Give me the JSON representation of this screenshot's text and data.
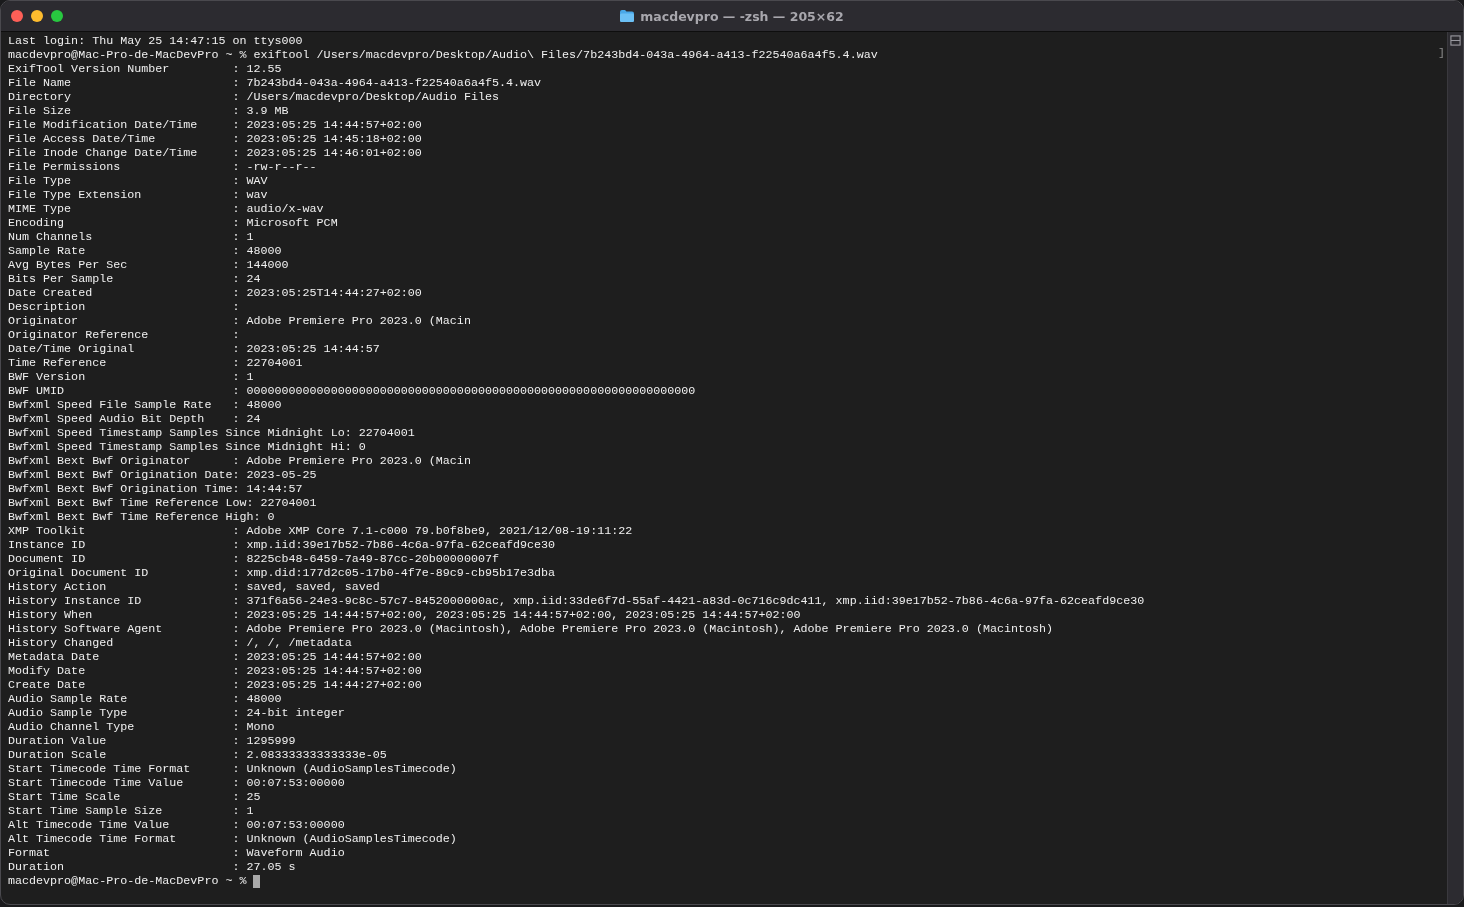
{
  "window": {
    "title": "macdevpro — -zsh — 205×62"
  },
  "terminal": {
    "lines": [
      "Last login: Thu May 25 14:47:15 on ttys000",
      "macdevpro@Mac-Pro-de-MacDevPro ~ % exiftool /Users/macdevpro/Desktop/Audio\\ Files/7b243bd4-043a-4964-a413-f22540a6a4f5.4.wav",
      "ExifTool Version Number         : 12.55",
      "File Name                       : 7b243bd4-043a-4964-a413-f22540a6a4f5.4.wav",
      "Directory                       : /Users/macdevpro/Desktop/Audio Files",
      "File Size                       : 3.9 MB",
      "File Modification Date/Time     : 2023:05:25 14:44:57+02:00",
      "File Access Date/Time           : 2023:05:25 14:45:18+02:00",
      "File Inode Change Date/Time     : 2023:05:25 14:46:01+02:00",
      "File Permissions                : -rw-r--r--",
      "File Type                       : WAV",
      "File Type Extension             : wav",
      "MIME Type                       : audio/x-wav",
      "Encoding                        : Microsoft PCM",
      "Num Channels                    : 1",
      "Sample Rate                     : 48000",
      "Avg Bytes Per Sec               : 144000",
      "Bits Per Sample                 : 24",
      "Date Created                    : 2023:05:25T14:44:27+02:00",
      "Description                     :",
      "Originator                      : Adobe Premiere Pro 2023.0 (Macin",
      "Originator Reference            :",
      "Date/Time Original              : 2023:05:25 14:44:57",
      "Time Reference                  : 22704001",
      "BWF Version                     : 1",
      "BWF UMID                        : 0000000000000000000000000000000000000000000000000000000000000000",
      "Bwfxml Speed File Sample Rate   : 48000",
      "Bwfxml Speed Audio Bit Depth    : 24",
      "Bwfxml Speed Timestamp Samples Since Midnight Lo: 22704001",
      "Bwfxml Speed Timestamp Samples Since Midnight Hi: 0",
      "Bwfxml Bext Bwf Originator      : Adobe Premiere Pro 2023.0 (Macin",
      "Bwfxml Bext Bwf Origination Date: 2023-05-25",
      "Bwfxml Bext Bwf Origination Time: 14:44:57",
      "Bwfxml Bext Bwf Time Reference Low: 22704001",
      "Bwfxml Bext Bwf Time Reference High: 0",
      "XMP Toolkit                     : Adobe XMP Core 7.1-c000 79.b0f8be9, 2021/12/08-19:11:22",
      "Instance ID                     : xmp.iid:39e17b52-7b86-4c6a-97fa-62ceafd9ce30",
      "Document ID                     : 8225cb48-6459-7a49-87cc-20b00000007f",
      "Original Document ID            : xmp.did:177d2c05-17b0-4f7e-89c9-cb95b17e3dba",
      "History Action                  : saved, saved, saved",
      "History Instance ID             : 371f6a56-24e3-9c8c-57c7-8452000000ac, xmp.iid:33de6f7d-55af-4421-a83d-0c716c9dc411, xmp.iid:39e17b52-7b86-4c6a-97fa-62ceafd9ce30",
      "History When                    : 2023:05:25 14:44:57+02:00, 2023:05:25 14:44:57+02:00, 2023:05:25 14:44:57+02:00",
      "History Software Agent          : Adobe Premiere Pro 2023.0 (Macintosh), Adobe Premiere Pro 2023.0 (Macintosh), Adobe Premiere Pro 2023.0 (Macintosh)",
      "History Changed                 : /, /, /metadata",
      "Metadata Date                   : 2023:05:25 14:44:57+02:00",
      "Modify Date                     : 2023:05:25 14:44:57+02:00",
      "Create Date                     : 2023:05:25 14:44:27+02:00",
      "Audio Sample Rate               : 48000",
      "Audio Sample Type               : 24-bit integer",
      "Audio Channel Type              : Mono",
      "Duration Value                  : 1295999",
      "Duration Scale                  : 2.08333333333333e-05",
      "Start Timecode Time Format      : Unknown (AudioSamplesTimecode)",
      "Start Timecode Time Value       : 00:07:53:00000",
      "Start Time Scale                : 25",
      "Start Time Sample Size          : 1",
      "Alt Timecode Time Value         : 00:07:53:00000",
      "Alt Timecode Time Format        : Unknown (AudioSamplesTimecode)",
      "Format                          : Waveform Audio",
      "Duration                        : 27.05 s"
    ],
    "prompt": "macdevpro@Mac-Pro-de-MacDevPro ~ %",
    "mark": "]"
  }
}
